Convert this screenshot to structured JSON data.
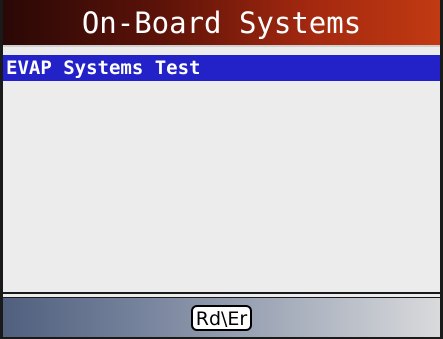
{
  "header": {
    "title": "On-Board Systems"
  },
  "menu": {
    "items": [
      {
        "label": "EVAP Systems Test",
        "selected": true
      }
    ]
  },
  "soft_keys": {
    "center_label": "Rd\\Er"
  },
  "colors": {
    "title_gradient_start": "#2a0806",
    "title_gradient_end": "#c13a12",
    "selection": "#2222c8",
    "list_background": "#ececec",
    "softkey_gradient_start": "#4f5f7d",
    "softkey_gradient_end": "#d9dadc"
  }
}
